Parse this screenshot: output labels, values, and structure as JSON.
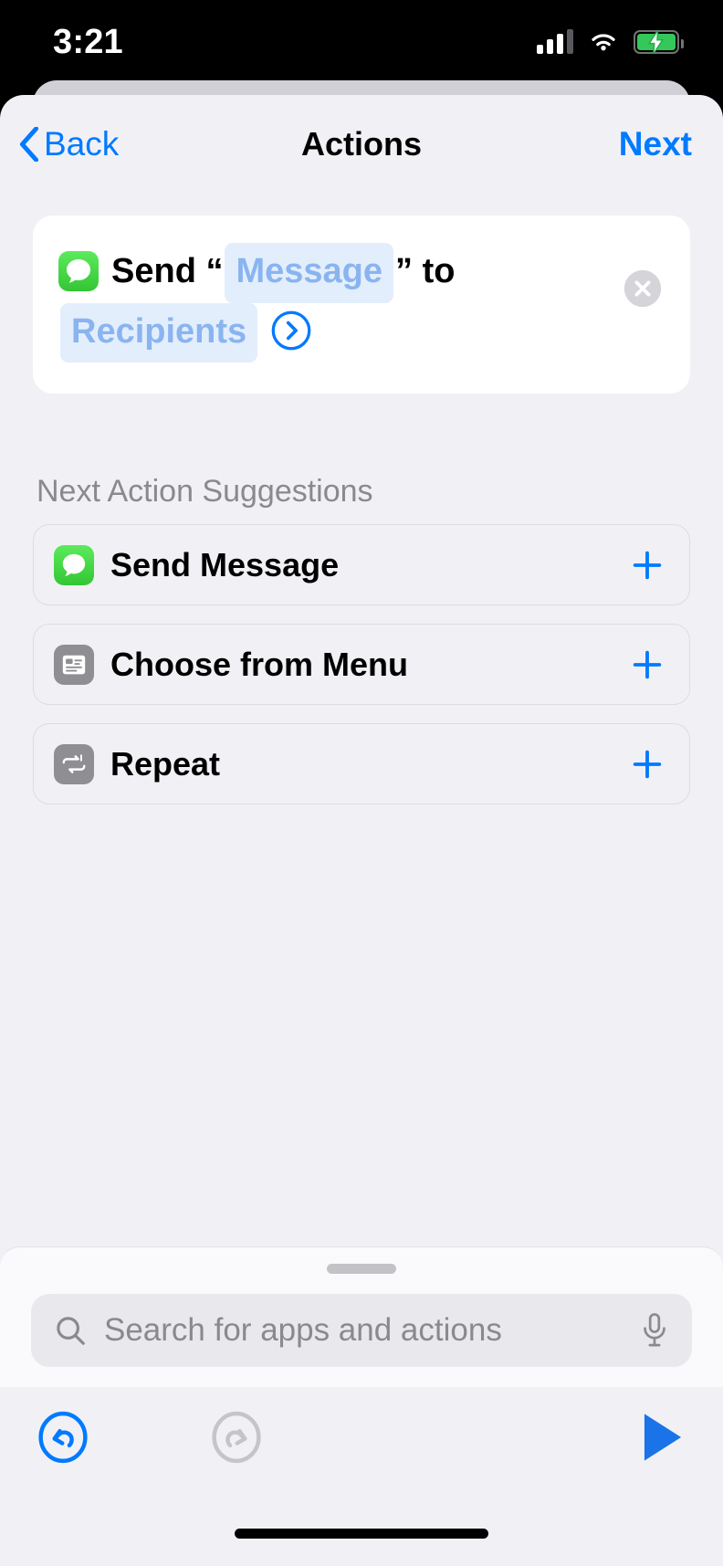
{
  "status_bar": {
    "time": "3:21",
    "cellular_icon": "cellular-bars-icon",
    "wifi_icon": "wifi-icon",
    "battery_icon": "battery-charging-icon",
    "battery_charging": true,
    "battery_color": "#34c759"
  },
  "nav": {
    "back_label": "Back",
    "title": "Actions",
    "next_label": "Next",
    "accent_color": "#007aff"
  },
  "action_card": {
    "app_icon": "messages-app-icon",
    "verb": "Send",
    "open_quote": "“",
    "close_quote": "”",
    "message_token": "Message",
    "connector": "to",
    "recipients_token": "Recipients",
    "disclosure_icon": "chevron-right-circle-icon",
    "remove_icon": "close-circle-icon",
    "token_bg": "#e3eefc",
    "token_fg": "#8ab4f0"
  },
  "suggestions": {
    "heading": "Next Action Suggestions",
    "items": [
      {
        "label": "Send Message",
        "icon": "messages-app-icon",
        "icon_style": "green",
        "add_icon": "plus-icon"
      },
      {
        "label": "Choose from Menu",
        "icon": "menu-list-icon",
        "icon_style": "gray",
        "add_icon": "plus-icon"
      },
      {
        "label": "Repeat",
        "icon": "repeat-one-icon",
        "icon_style": "gray",
        "add_icon": "plus-icon"
      }
    ]
  },
  "search": {
    "placeholder": "Search for apps and actions",
    "search_icon": "search-icon",
    "mic_icon": "microphone-icon",
    "grabber": "sheet-grabber"
  },
  "toolbar": {
    "undo_icon": "undo-icon",
    "undo_enabled": true,
    "redo_icon": "redo-icon",
    "redo_enabled": false,
    "run_icon": "play-icon",
    "enabled_color": "#007aff",
    "disabled_color": "#c4c4c9"
  }
}
